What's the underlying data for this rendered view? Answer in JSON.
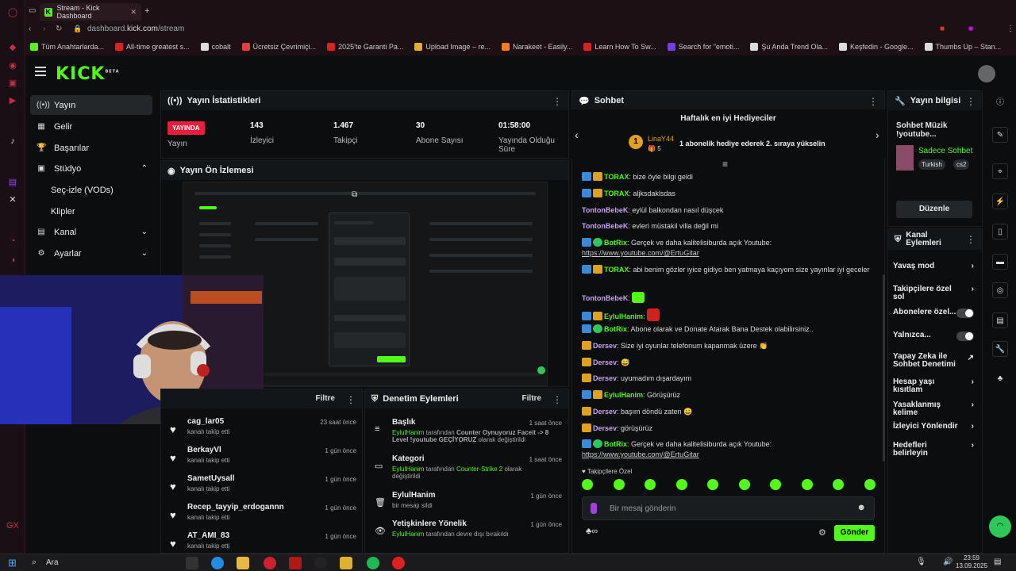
{
  "browser": {
    "tab_title": "Stream - Kick Dashboard",
    "url_host": "dashboard.",
    "url_domain": "kick.com",
    "url_path": "/stream",
    "bookmarks": [
      "Tüm Anahtarlarda...",
      "All-time greatest s...",
      "cobalt",
      "Ücretsiz Çevrimiçi...",
      "2025'te Garanti Pa...",
      "Upload Image – re...",
      "Narakeet - Easily...",
      "Learn How To Sw...",
      "Search for \"emoti...",
      "Şu Anda Trend Ola...",
      "Keşfedin - Google...",
      "Thumbs Up – Stan..."
    ]
  },
  "header": {
    "logo": "KICK",
    "beta": "BETA"
  },
  "sidebar": {
    "items": [
      {
        "label": "Yayın",
        "icon": "broadcast-icon"
      },
      {
        "label": "Gelir",
        "icon": "wallet-icon"
      },
      {
        "label": "Başarılar",
        "icon": "trophy-icon"
      },
      {
        "label": "Stüdyo",
        "icon": "studio-icon"
      },
      {
        "label": "Seç-izle (VODs)",
        "icon": ""
      },
      {
        "label": "Klipler",
        "icon": ""
      },
      {
        "label": "Kanal",
        "icon": "user-icon"
      },
      {
        "label": "Ayarlar",
        "icon": "gear-icon"
      }
    ]
  },
  "stats": {
    "title": "Yayın İstatistikleri",
    "live_badge": "YAYINDA",
    "live_label": "Yayın",
    "items": [
      {
        "value": "143",
        "label": "İzleyici"
      },
      {
        "value": "1.467",
        "label": "Takipçi"
      },
      {
        "value": "30",
        "label": "Abone Sayısı"
      },
      {
        "value": "01:58:00",
        "label": "Yayında Olduğu Süre"
      }
    ]
  },
  "preview": {
    "title": "Yayın Ön İzlemesi"
  },
  "follows": {
    "filter": "Filtre",
    "rows": [
      {
        "name": "cag_lar05",
        "sub": "kanalı takip etti",
        "time": "23 saat önce"
      },
      {
        "name": "BerkayVl",
        "sub": "kanalı takip etti",
        "time": "1 gün önce"
      },
      {
        "name": "SametUysall",
        "sub": "kanalı takip etti",
        "time": "1 gün önce"
      },
      {
        "name": "Recep_tayyip_erdogannn",
        "sub": "kanalı takip etti",
        "time": "1 gün önce"
      },
      {
        "name": "AT_AMI_83",
        "sub": "kanalı takip etti",
        "time": "1 gün önce"
      }
    ]
  },
  "mod": {
    "title": "Denetim Eylemleri",
    "filter": "Filtre",
    "rows": [
      {
        "title": "Başlık",
        "l1a": "EylulHanim",
        "l1b": " tarafından ",
        "l1c": "Counter Oynuyoruz Faceit -> 8",
        "l2": "Level !youtube GEÇİYORUZ",
        "l2b": " olarak değiştirildi",
        "time": "1 saat önce"
      },
      {
        "title": "Kategori",
        "l1a": "EylulHanim",
        "l1b": " tarafından ",
        "l1c": "Counter-Strike 2",
        "l2": "olarak",
        "l2b": "değiştirildi",
        "time": "1 saat önce"
      },
      {
        "title": "EylulHanim",
        "l1a": "bir mesajı sildi",
        "time": "1 gün önce"
      },
      {
        "title": "Yetişkinlere Yönelik",
        "l1a": "EylulHanim",
        "l1b": " tarafından devre dışı bırakıldı",
        "time": "1 gün önce"
      }
    ]
  },
  "chat": {
    "title": "Sohbet",
    "gifters_title": "Haftalık en iyi Hediyeciler",
    "top_gifter": "LinaY44",
    "top_gifter_count": "5",
    "gift_hint": "1 abonelik hediye ederek 2. sıraya yükselin",
    "messages": [
      {
        "user": "TORAX",
        "text": "bize öyle bilgi geldi",
        "color": "#53fc18"
      },
      {
        "user": "TORAX",
        "text": "aljksdaklsdas",
        "color": "#53fc18"
      },
      {
        "user": "TontonBebeK",
        "text": "eylül balkondan nasıl düşcek",
        "color": "#c9a2f0"
      },
      {
        "user": "TontonBebeK",
        "text": "evleri müstakil villa değil mi",
        "color": "#c9a2f0"
      },
      {
        "user": "BotRix",
        "text": "Gerçek ve daha kalitelisiburda açık Youtube:",
        "link": "https://www.youtube.com/@ErtuGitar",
        "color": "#53fc18"
      },
      {
        "user": "TORAX",
        "text": "abi benim gözler iyice gidiyo ben yatmaya kaçıyom size yayınlar iyi geceler",
        "color": "#53fc18"
      },
      {
        "user": "TontonBebeK",
        "text": "",
        "color": "#c9a2f0"
      },
      {
        "user": "EylulHanim",
        "text": "",
        "color": "#53fc18"
      },
      {
        "user": "BotRix",
        "text": "Abone olarak ve Donate Atarak Bana Destek olabilirsiniz..",
        "color": "#53fc18"
      },
      {
        "user": "Dersev",
        "text": "Size iyi oyunlar telefonum kapanmak üzere 👏",
        "color": "#c9a2f0"
      },
      {
        "user": "Dersev",
        "text": "😅",
        "color": "#c9a2f0"
      },
      {
        "user": "Dersev",
        "text": "uyumadım dışardayım",
        "color": "#c9a2f0"
      },
      {
        "user": "EylulHanim",
        "text": "Görüşürüz",
        "color": "#53fc18"
      },
      {
        "user": "Dersev",
        "text": "başım döndü zaten 😄",
        "color": "#c9a2f0"
      },
      {
        "user": "Dersev",
        "text": "görüşürüz",
        "color": "#c9a2f0"
      },
      {
        "user": "BotRix",
        "text": "Gerçek ve daha kalitelisiburda açık Youtube:",
        "link": "https://www.youtube.com/@ErtuGitar",
        "color": "#53fc18"
      }
    ],
    "follower_emotes": "Takipçilere Özel",
    "input_placeholder": "Bir mesaj gönderin",
    "send": "Gönder"
  },
  "info": {
    "title": "Yayın bilgisi",
    "stream_title": "Sohbet Müzik !youtube...",
    "category": "Sadece Sohbet",
    "tags": [
      "Turkish",
      "cs2"
    ],
    "edit": "Düzenle"
  },
  "actions": {
    "title": "Kanal Eylemleri",
    "items": [
      "Yavaş mod",
      "Takipçilere özel sol",
      "Abonelere özel...",
      "Yalnızca...",
      "Yapay Zeka ile Sohbet Denetimi",
      "Hesap yaşı kısıtlam",
      "Yasaklanmış kelime",
      "İzleyici Yönlendir",
      "Hedefleri belirleyin"
    ]
  },
  "taskbar": {
    "search": "Ara",
    "time": "23:59",
    "date": "13.09.2025"
  },
  "colors": {
    "accent": "#53fc18",
    "live": "#e91e3c",
    "bg": "#0b0d0e"
  }
}
